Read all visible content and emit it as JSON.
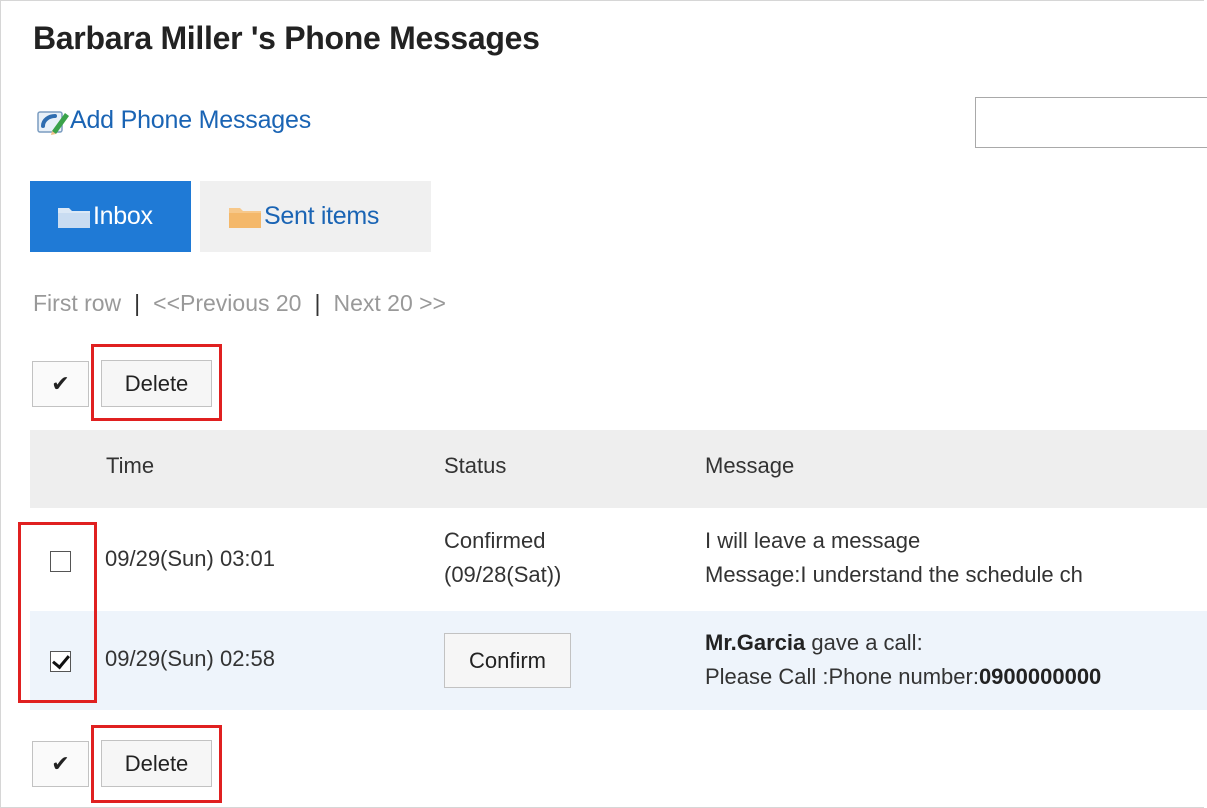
{
  "title": "Barbara Miller 's Phone Messages",
  "add_link": {
    "label": "Add Phone Messages",
    "icon": "phone-pencil-icon"
  },
  "search": {
    "value": ""
  },
  "tabs": [
    {
      "label": "Inbox",
      "active": true,
      "icon": "folder-icon"
    },
    {
      "label": "Sent items",
      "active": false,
      "icon": "folder-icon"
    }
  ],
  "pager": {
    "first": "First row",
    "separator": "|",
    "previous": "<<Previous 20",
    "next": "Next 20 >>"
  },
  "actions": {
    "check_all_symbol": "✔",
    "delete_label": "Delete"
  },
  "table": {
    "headers": {
      "time": "Time",
      "status": "Status",
      "message": "Message"
    },
    "rows": [
      {
        "checked": false,
        "time": "09/29(Sun) 03:01",
        "status_line1": "Confirmed",
        "status_line2": "(09/28(Sat))",
        "message_line1": "I will leave a message",
        "message_line2": "Message:I understand the schedule ch"
      },
      {
        "checked": true,
        "time": "09/29(Sun) 02:58",
        "confirm_label": "Confirm",
        "caller": "Mr.Garcia",
        "caller_suffix": " gave a call:",
        "message_prefix": "Please Call :Phone number:",
        "phone_number": "0900000000"
      }
    ]
  },
  "colors": {
    "accent": "#1f7ad6",
    "link": "#1a64b4",
    "highlight": "#e02020",
    "row_alt": "#eef4fb"
  }
}
